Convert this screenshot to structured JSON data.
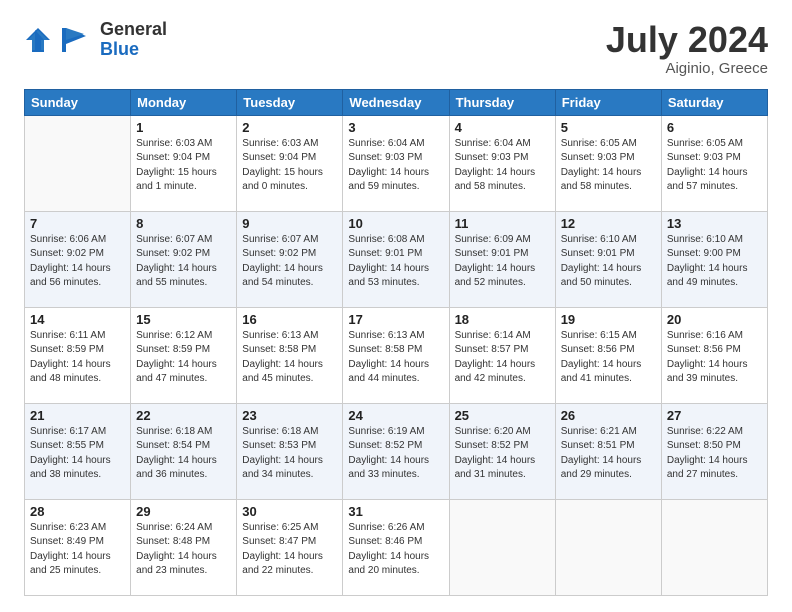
{
  "header": {
    "logo_general": "General",
    "logo_blue": "Blue",
    "month": "July 2024",
    "location": "Aiginio, Greece"
  },
  "weekdays": [
    "Sunday",
    "Monday",
    "Tuesday",
    "Wednesday",
    "Thursday",
    "Friday",
    "Saturday"
  ],
  "weeks": [
    [
      {
        "day": "",
        "sunrise": "",
        "sunset": "",
        "daylight": ""
      },
      {
        "day": "1",
        "sunrise": "Sunrise: 6:03 AM",
        "sunset": "Sunset: 9:04 PM",
        "daylight": "Daylight: 15 hours and 1 minute."
      },
      {
        "day": "2",
        "sunrise": "Sunrise: 6:03 AM",
        "sunset": "Sunset: 9:04 PM",
        "daylight": "Daylight: 15 hours and 0 minutes."
      },
      {
        "day": "3",
        "sunrise": "Sunrise: 6:04 AM",
        "sunset": "Sunset: 9:03 PM",
        "daylight": "Daylight: 14 hours and 59 minutes."
      },
      {
        "day": "4",
        "sunrise": "Sunrise: 6:04 AM",
        "sunset": "Sunset: 9:03 PM",
        "daylight": "Daylight: 14 hours and 58 minutes."
      },
      {
        "day": "5",
        "sunrise": "Sunrise: 6:05 AM",
        "sunset": "Sunset: 9:03 PM",
        "daylight": "Daylight: 14 hours and 58 minutes."
      },
      {
        "day": "6",
        "sunrise": "Sunrise: 6:05 AM",
        "sunset": "Sunset: 9:03 PM",
        "daylight": "Daylight: 14 hours and 57 minutes."
      }
    ],
    [
      {
        "day": "7",
        "sunrise": "Sunrise: 6:06 AM",
        "sunset": "Sunset: 9:02 PM",
        "daylight": "Daylight: 14 hours and 56 minutes."
      },
      {
        "day": "8",
        "sunrise": "Sunrise: 6:07 AM",
        "sunset": "Sunset: 9:02 PM",
        "daylight": "Daylight: 14 hours and 55 minutes."
      },
      {
        "day": "9",
        "sunrise": "Sunrise: 6:07 AM",
        "sunset": "Sunset: 9:02 PM",
        "daylight": "Daylight: 14 hours and 54 minutes."
      },
      {
        "day": "10",
        "sunrise": "Sunrise: 6:08 AM",
        "sunset": "Sunset: 9:01 PM",
        "daylight": "Daylight: 14 hours and 53 minutes."
      },
      {
        "day": "11",
        "sunrise": "Sunrise: 6:09 AM",
        "sunset": "Sunset: 9:01 PM",
        "daylight": "Daylight: 14 hours and 52 minutes."
      },
      {
        "day": "12",
        "sunrise": "Sunrise: 6:10 AM",
        "sunset": "Sunset: 9:01 PM",
        "daylight": "Daylight: 14 hours and 50 minutes."
      },
      {
        "day": "13",
        "sunrise": "Sunrise: 6:10 AM",
        "sunset": "Sunset: 9:00 PM",
        "daylight": "Daylight: 14 hours and 49 minutes."
      }
    ],
    [
      {
        "day": "14",
        "sunrise": "Sunrise: 6:11 AM",
        "sunset": "Sunset: 8:59 PM",
        "daylight": "Daylight: 14 hours and 48 minutes."
      },
      {
        "day": "15",
        "sunrise": "Sunrise: 6:12 AM",
        "sunset": "Sunset: 8:59 PM",
        "daylight": "Daylight: 14 hours and 47 minutes."
      },
      {
        "day": "16",
        "sunrise": "Sunrise: 6:13 AM",
        "sunset": "Sunset: 8:58 PM",
        "daylight": "Daylight: 14 hours and 45 minutes."
      },
      {
        "day": "17",
        "sunrise": "Sunrise: 6:13 AM",
        "sunset": "Sunset: 8:58 PM",
        "daylight": "Daylight: 14 hours and 44 minutes."
      },
      {
        "day": "18",
        "sunrise": "Sunrise: 6:14 AM",
        "sunset": "Sunset: 8:57 PM",
        "daylight": "Daylight: 14 hours and 42 minutes."
      },
      {
        "day": "19",
        "sunrise": "Sunrise: 6:15 AM",
        "sunset": "Sunset: 8:56 PM",
        "daylight": "Daylight: 14 hours and 41 minutes."
      },
      {
        "day": "20",
        "sunrise": "Sunrise: 6:16 AM",
        "sunset": "Sunset: 8:56 PM",
        "daylight": "Daylight: 14 hours and 39 minutes."
      }
    ],
    [
      {
        "day": "21",
        "sunrise": "Sunrise: 6:17 AM",
        "sunset": "Sunset: 8:55 PM",
        "daylight": "Daylight: 14 hours and 38 minutes."
      },
      {
        "day": "22",
        "sunrise": "Sunrise: 6:18 AM",
        "sunset": "Sunset: 8:54 PM",
        "daylight": "Daylight: 14 hours and 36 minutes."
      },
      {
        "day": "23",
        "sunrise": "Sunrise: 6:18 AM",
        "sunset": "Sunset: 8:53 PM",
        "daylight": "Daylight: 14 hours and 34 minutes."
      },
      {
        "day": "24",
        "sunrise": "Sunrise: 6:19 AM",
        "sunset": "Sunset: 8:52 PM",
        "daylight": "Daylight: 14 hours and 33 minutes."
      },
      {
        "day": "25",
        "sunrise": "Sunrise: 6:20 AM",
        "sunset": "Sunset: 8:52 PM",
        "daylight": "Daylight: 14 hours and 31 minutes."
      },
      {
        "day": "26",
        "sunrise": "Sunrise: 6:21 AM",
        "sunset": "Sunset: 8:51 PM",
        "daylight": "Daylight: 14 hours and 29 minutes."
      },
      {
        "day": "27",
        "sunrise": "Sunrise: 6:22 AM",
        "sunset": "Sunset: 8:50 PM",
        "daylight": "Daylight: 14 hours and 27 minutes."
      }
    ],
    [
      {
        "day": "28",
        "sunrise": "Sunrise: 6:23 AM",
        "sunset": "Sunset: 8:49 PM",
        "daylight": "Daylight: 14 hours and 25 minutes."
      },
      {
        "day": "29",
        "sunrise": "Sunrise: 6:24 AM",
        "sunset": "Sunset: 8:48 PM",
        "daylight": "Daylight: 14 hours and 23 minutes."
      },
      {
        "day": "30",
        "sunrise": "Sunrise: 6:25 AM",
        "sunset": "Sunset: 8:47 PM",
        "daylight": "Daylight: 14 hours and 22 minutes."
      },
      {
        "day": "31",
        "sunrise": "Sunrise: 6:26 AM",
        "sunset": "Sunset: 8:46 PM",
        "daylight": "Daylight: 14 hours and 20 minutes."
      },
      {
        "day": "",
        "sunrise": "",
        "sunset": "",
        "daylight": ""
      },
      {
        "day": "",
        "sunrise": "",
        "sunset": "",
        "daylight": ""
      },
      {
        "day": "",
        "sunrise": "",
        "sunset": "",
        "daylight": ""
      }
    ]
  ]
}
